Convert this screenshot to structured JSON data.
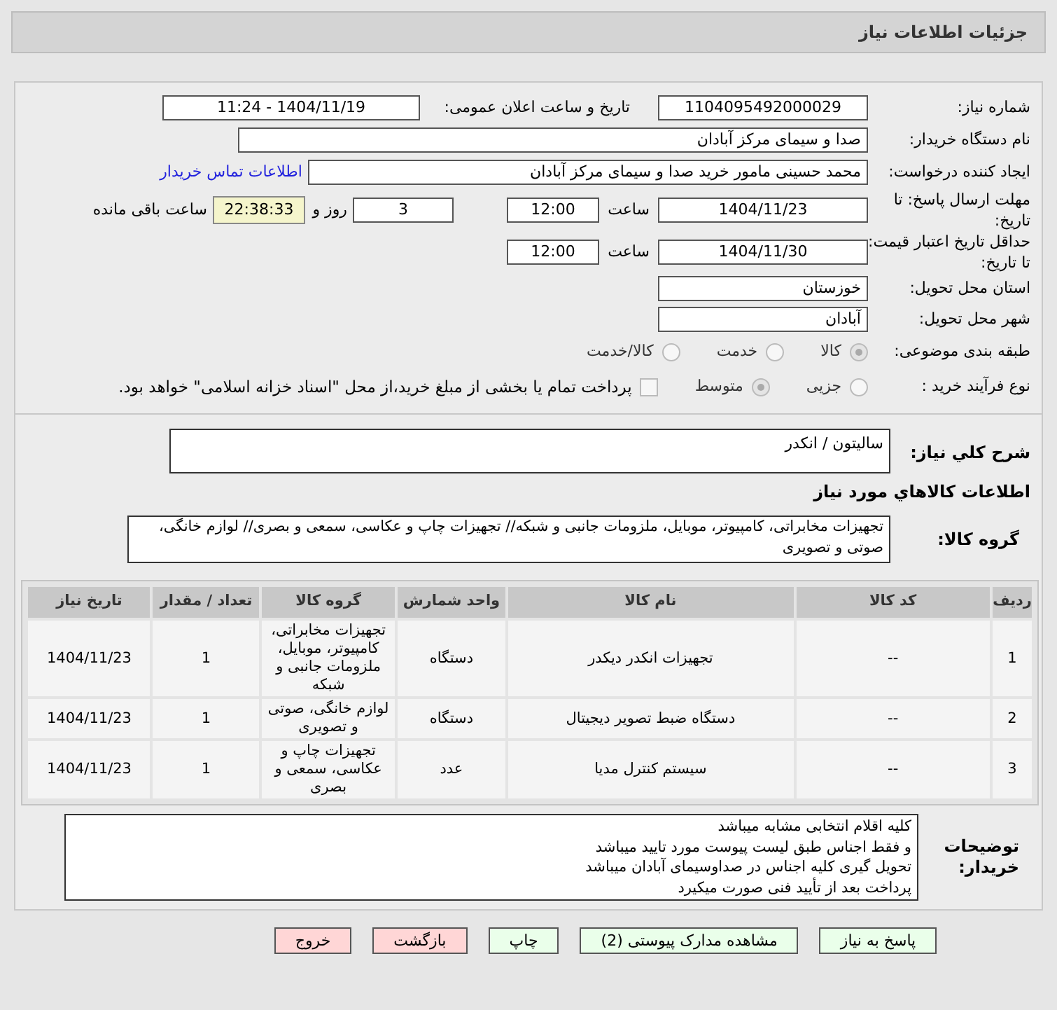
{
  "header": {
    "title": "جزئیات اطلاعات نیاز"
  },
  "form": {
    "need_number": {
      "label": "شماره نیاز:",
      "value": "1104095492000029"
    },
    "announce": {
      "label": "تاریخ و ساعت اعلان عمومی:",
      "value": "1404/11/19 - 11:24"
    },
    "buyer": {
      "label": "نام دستگاه خریدار:",
      "value": "صدا و سیمای مرکز آبادان"
    },
    "requester": {
      "label": "ایجاد کننده درخواست:",
      "value": "محمد حسینی مامور خرید  صدا و سیمای مرکز آبادان",
      "link": "اطلاعات تماس خریدار"
    },
    "deadline": {
      "label": "مهلت ارسال پاسخ: تا تاریخ:",
      "date": "1404/11/23",
      "time_label": "ساعت",
      "time": "12:00",
      "days": "3",
      "days_label": "روز و",
      "remaining": "22:38:33",
      "remaining_label": "ساعت باقی مانده"
    },
    "validity": {
      "label": "حداقل تاریخ اعتبار قیمت: تا تاریخ:",
      "date": "1404/11/30",
      "time_label": "ساعت",
      "time": "12:00"
    },
    "province": {
      "label": "استان محل تحویل:",
      "value": "خوزستان"
    },
    "city": {
      "label": "شهر محل تحویل:",
      "value": "آبادان"
    },
    "category": {
      "label": "طبقه بندی موضوعی:",
      "options": [
        {
          "label": "کالا",
          "selected": true
        },
        {
          "label": "خدمت",
          "selected": false
        },
        {
          "label": "کالا/خدمت",
          "selected": false
        }
      ]
    },
    "process": {
      "label": "نوع فرآیند خرید :",
      "options": [
        {
          "label": "جزیی",
          "selected": false
        },
        {
          "label": "متوسط",
          "selected": true
        }
      ],
      "payment": {
        "checked": false,
        "label": "پرداخت تمام یا بخشی از مبلغ خرید،از محل \"اسناد خزانه اسلامی\" خواهد بود."
      }
    }
  },
  "description": {
    "label": "شرح کلي نياز:",
    "value": "سالیتون / انکدر"
  },
  "goods": {
    "title": "اطلاعات کالاهاي مورد نياز",
    "group_label": "گروه کالا:",
    "group_value": "تجهیزات مخابراتی، کامپیوتر، موبایل، ملزومات جانبی و شبکه// تجهیزات چاپ و عکاسی، سمعی و بصری// لوازم خانگی، صوتی و تصویری"
  },
  "table": {
    "columns": [
      "ردیف",
      "کد کالا",
      "نام کالا",
      "واحد شمارش",
      "گروه کالا",
      "تعداد / مقدار",
      "تاریخ نیاز"
    ],
    "rows": [
      [
        "1",
        "--",
        "تجهیزات انکدر دیکدر",
        "دستگاه",
        "تجهیزات مخابراتی، کامپیوتر، موبایل، ملزومات جانبی و شبکه",
        "1",
        "1404/11/23"
      ],
      [
        "2",
        "--",
        "دستگاه ضبط تصویر دیجیتال",
        "دستگاه",
        "لوازم خانگی، صوتی و تصویری",
        "1",
        "1404/11/23"
      ],
      [
        "3",
        "--",
        "سیستم کنترل مدیا",
        "عدد",
        "تجهیزات چاپ و عکاسی، سمعی و بصری",
        "1",
        "1404/11/23"
      ]
    ]
  },
  "notes": {
    "label": "توضیحات خریدار:",
    "lines": [
      "کلیه اقلام انتخابی مشابه میباشد",
      "و فقط اجناس طبق لیست پیوست مورد تایید میباشد",
      "تحویل گیری کلیه اجناس در صداوسیمای آبادان میباشد",
      "پرداخت بعد از تأیید فنی صورت میکیرد"
    ]
  },
  "buttons": [
    {
      "label": "پاسخ به نیاز",
      "kind": "green"
    },
    {
      "label": "مشاهده مدارک پیوستی (2)",
      "kind": "green"
    },
    {
      "label": "چاپ",
      "kind": "green"
    },
    {
      "label": "بازگشت",
      "kind": "red"
    },
    {
      "label": "خروج",
      "kind": "red"
    }
  ]
}
